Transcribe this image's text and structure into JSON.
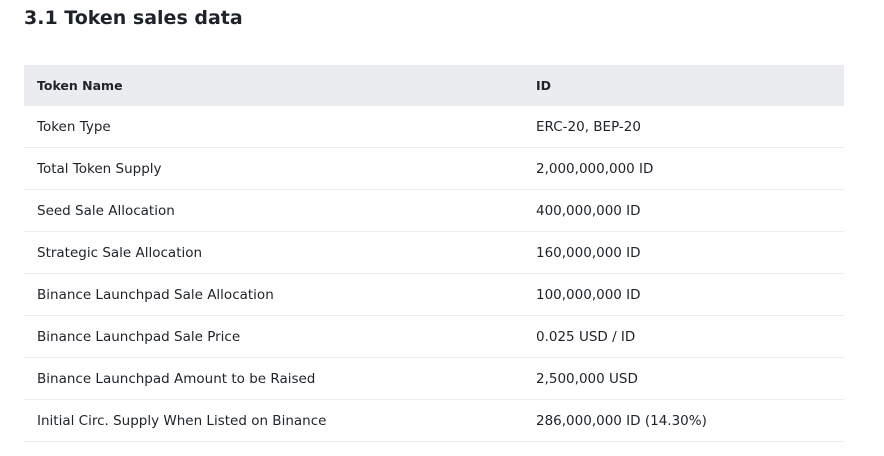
{
  "page": {
    "title": "3.1 Token sales data"
  },
  "table": {
    "headers": [
      "Token Name",
      "ID"
    ],
    "rows": [
      [
        "Token Type",
        "ERC-20, BEP-20"
      ],
      [
        "Total Token Supply",
        "2,000,000,000 ID"
      ],
      [
        "Seed Sale Allocation",
        "400,000,000 ID"
      ],
      [
        "Strategic Sale Allocation",
        "160,000,000 ID"
      ],
      [
        "Binance Launchpad Sale Allocation",
        "100,000,000 ID"
      ],
      [
        "Binance Launchpad Sale Price",
        "0.025 USD / ID"
      ],
      [
        "Binance Launchpad Amount to be Raised",
        "2,500,000 USD"
      ],
      [
        "Initial Circ. Supply When Listed on Binance",
        "286,000,000 ID (14.30%)"
      ]
    ]
  },
  "colors": {
    "header_background": "#eaecef",
    "text": "#1e2329",
    "row_divider": "#eaecef"
  }
}
